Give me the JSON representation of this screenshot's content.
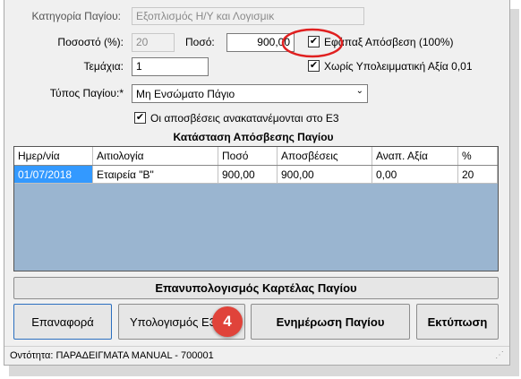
{
  "asset": {
    "category_label": "Κατηγορία Παγίου:",
    "category_value": "Εξοπλισμός Η/Υ και Λογισμικ",
    "percent_label": "Ποσοστό (%):",
    "percent_value": "20",
    "amount_label": "Ποσό:",
    "amount_value": "900,00",
    "one_time_label": "Εφάπαξ Απόσβεση (100%)",
    "one_time_checked": "✔",
    "pieces_label": "Τεμάχια:",
    "pieces_value": "1",
    "no_residual_label": "Χωρίς Υπολειμματική Αξία 0,01",
    "no_residual_checked": "✔",
    "type_label": "Τύπος Παγίου:*",
    "type_value": "Μη Ενσώματο Πάγιο",
    "redistribute_label": "Οι αποσβέσεις ανακατανέμονται στο Ε3",
    "redistribute_checked": "✔"
  },
  "depreciation": {
    "title": "Κατάσταση Απόσβεσης Παγίου",
    "columns": [
      "Ημερ/νία",
      "Αιτιολογία",
      "Ποσό",
      "Αποσβέσεις",
      "Αναπ. Αξία",
      "%"
    ],
    "rows": [
      [
        "01/07/2018",
        "Εταιρεία \"B\"",
        "900,00",
        "900,00",
        "0,00",
        "20"
      ]
    ]
  },
  "buttons": {
    "recalc": "Επανυπολογισμός Καρτέλας Παγίου",
    "reset": "Επαναφορά",
    "calculate": "Υπολογισμός Ε3",
    "update": "Ενημέρωση Παγίου",
    "print": "Εκτύπωση"
  },
  "callout": {
    "step": "4"
  },
  "status": {
    "text": "Οντότητα:  ΠΑΡΑΔΕΙΓΜΑΤΑ MANUAL   -   700001"
  },
  "colors": {
    "callout": "#e0433a",
    "grid_bg": "#9ab5d0",
    "selected": "#3399ff",
    "highlight_ring": "#e02020"
  }
}
